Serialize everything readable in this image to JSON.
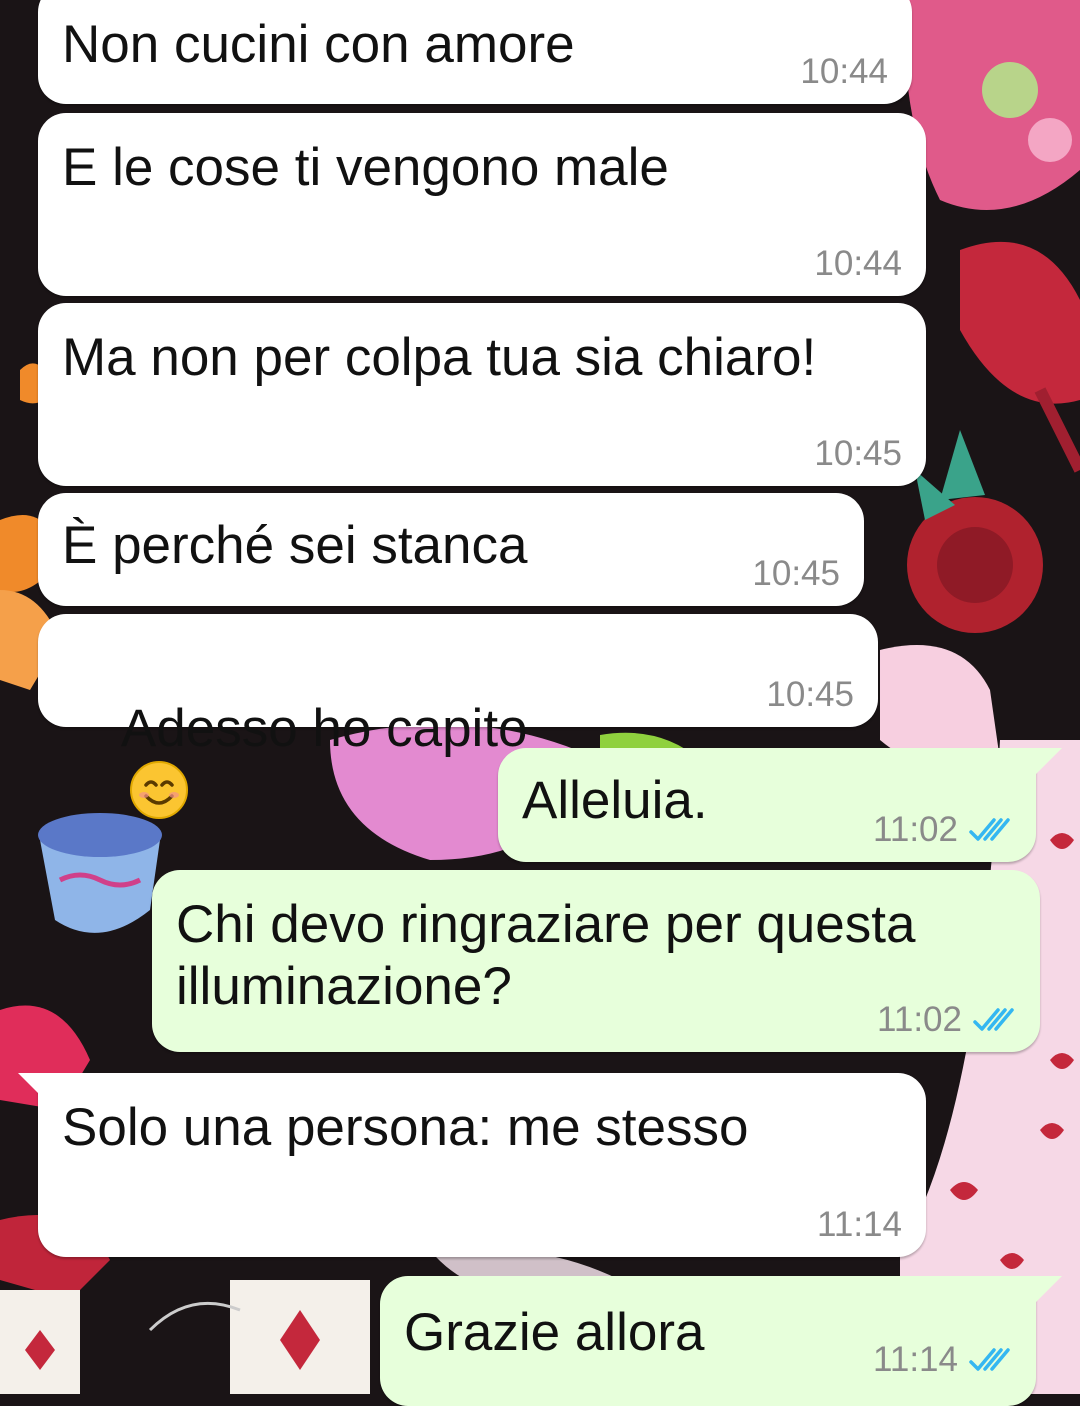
{
  "colors": {
    "incoming_bubble": "#ffffff",
    "outgoing_bubble": "#e7ffdb",
    "timestamp": "#8a8a8a",
    "read_ticks": "#34b7f1",
    "wallpaper": "#1a1416"
  },
  "messages": [
    {
      "direction": "incoming",
      "text": "Non cucini con amore",
      "time": "10:44"
    },
    {
      "direction": "incoming",
      "text": "E le cose ti vengono male",
      "time": "10:44"
    },
    {
      "direction": "incoming",
      "text": "Ma non per colpa tua sia chiaro!",
      "time": "10:45"
    },
    {
      "direction": "incoming",
      "text": "È perché sei stanca",
      "time": "10:45"
    },
    {
      "direction": "incoming",
      "text": "Adesso ho capito",
      "emoji": "smiling-face-icon",
      "time": "10:45"
    },
    {
      "direction": "outgoing",
      "text": "Alleluia.",
      "time": "11:02",
      "status_icon": "double-check-read-icon"
    },
    {
      "direction": "outgoing",
      "text": "Chi devo ringraziare per questa\nilluminazione?",
      "time": "11:02",
      "status_icon": "double-check-read-icon"
    },
    {
      "direction": "incoming",
      "text": "Solo una persona: me stesso",
      "time": "11:14"
    },
    {
      "direction": "outgoing",
      "text": "Grazie allora",
      "time": "11:14",
      "status_icon": "double-check-read-icon"
    }
  ]
}
